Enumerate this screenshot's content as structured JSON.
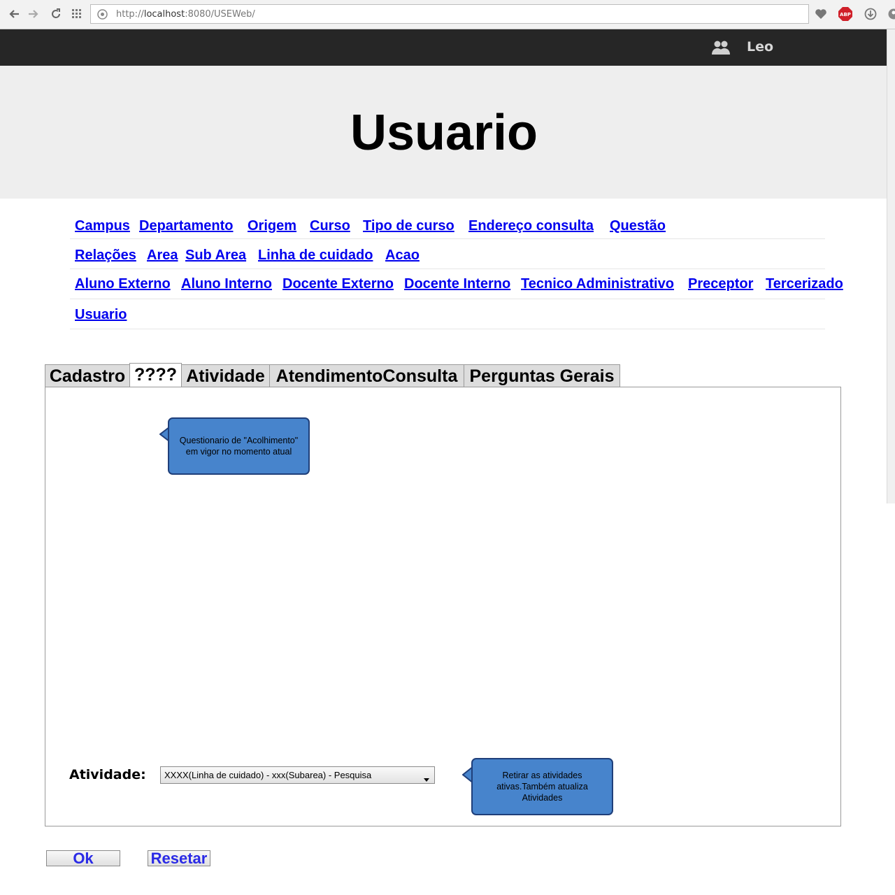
{
  "browser": {
    "url_prefix": "http://",
    "url_host": "localhost",
    "url_rest": ":8080/USEWeb/",
    "adblock_label": "ABP"
  },
  "user_bar": {
    "username": "Leo"
  },
  "header": {
    "title": "Usuario"
  },
  "nav_links": {
    "row1": [
      "Campus",
      "Departamento",
      "Origem",
      "Curso",
      "Tipo de curso",
      "Endereço consulta",
      "Questão"
    ],
    "row2": [
      "Relações",
      "Area",
      "Sub Area",
      "Linha de cuidado",
      "Acao"
    ],
    "row3": [
      "Aluno Externo",
      "Aluno Interno",
      "Docente Externo",
      "Docente Interno",
      "Tecnico Administrativo",
      "Preceptor",
      "Tercerizado"
    ],
    "row4": [
      "Usuario"
    ]
  },
  "tabs": [
    "Cadastro",
    "????",
    "Atividade",
    "AtendimentoConsulta",
    "Perguntas Gerais"
  ],
  "callouts": {
    "top": "Questionario de \"Acolhimento\" em vigor no momento atual",
    "bottom": "Retirar as atividades ativas.Também atualiza Atividades"
  },
  "form": {
    "atividade_label": "Atividade:",
    "atividade_value": "XXXX(Linha de cuidado) - xxx(Subarea) - Pesquisa"
  },
  "buttons": {
    "ok": "Ok",
    "reset": "Resetar"
  },
  "colors": {
    "link": "#0000ee",
    "callout": "#4784cc",
    "user_bar": "#262626",
    "header_bg": "#eeeeee"
  }
}
